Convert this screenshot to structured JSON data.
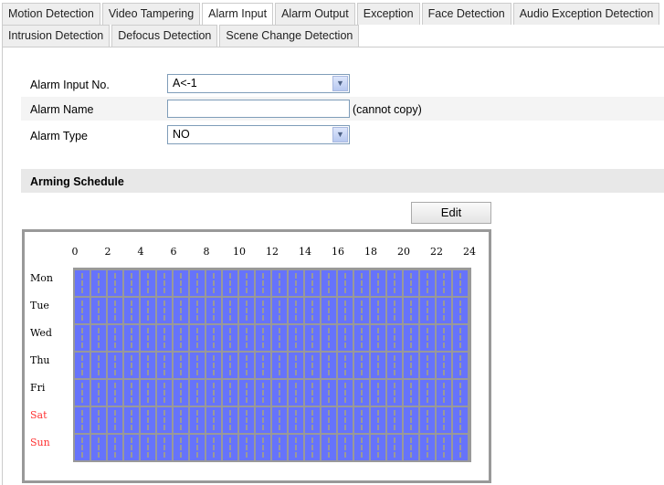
{
  "tabs_row1": [
    {
      "label": "Motion Detection"
    },
    {
      "label": "Video Tampering"
    },
    {
      "label": "Alarm Input",
      "active": true
    },
    {
      "label": "Alarm Output"
    },
    {
      "label": "Exception"
    },
    {
      "label": "Face Detection"
    },
    {
      "label": "Audio Exception Detection"
    }
  ],
  "tabs_row2": [
    {
      "label": "Intrusion Detection"
    },
    {
      "label": "Defocus Detection"
    },
    {
      "label": "Scene Change Detection"
    }
  ],
  "form": {
    "alarm_input_no_label": "Alarm Input No.",
    "alarm_input_no_value": "A<-1",
    "alarm_name_label": "Alarm Name",
    "alarm_name_value": "",
    "alarm_name_note": "(cannot copy)",
    "alarm_type_label": "Alarm Type",
    "alarm_type_value": "NO"
  },
  "schedule": {
    "title": "Arming Schedule",
    "edit_label": "Edit",
    "hours": [
      "0",
      "2",
      "4",
      "6",
      "8",
      "10",
      "12",
      "14",
      "16",
      "18",
      "20",
      "22",
      "24"
    ],
    "days": [
      {
        "label": "Mon",
        "weekend": false
      },
      {
        "label": "Tue",
        "weekend": false
      },
      {
        "label": "Wed",
        "weekend": false
      },
      {
        "label": "Thu",
        "weekend": false
      },
      {
        "label": "Fri",
        "weekend": false
      },
      {
        "label": "Sat",
        "weekend": true
      },
      {
        "label": "Sun",
        "weekend": true
      }
    ],
    "armed_hours": "0-24 all days",
    "weekend_color": "#ff3333",
    "armed_color": "#6673fb"
  }
}
